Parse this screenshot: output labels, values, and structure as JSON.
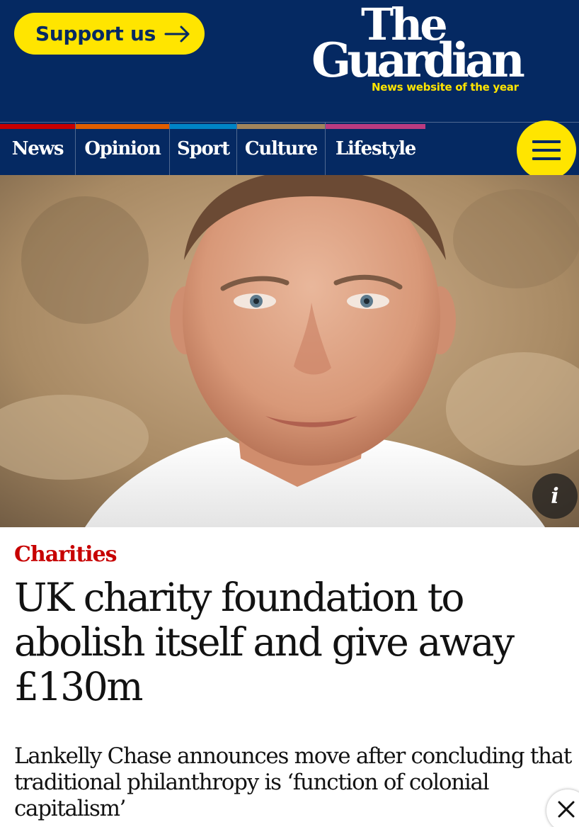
{
  "header": {
    "support_label": "Support us",
    "logo_line1": "The",
    "logo_line2": "Guardian",
    "tagline": "News website of the year"
  },
  "nav": {
    "items": [
      {
        "label": "News",
        "color": "#c70000"
      },
      {
        "label": "Opinion",
        "color": "#e05e00"
      },
      {
        "label": "Sport",
        "color": "#0084c6"
      },
      {
        "label": "Culture",
        "color": "#a1845c"
      },
      {
        "label": "Lifestyle",
        "color": "#bb3b80"
      }
    ]
  },
  "article": {
    "section": "Charities",
    "headline": "UK charity foundation to abolish itself and give away £130m",
    "standfirst": "Lankelly Chase announces move after concluding that traditional philanthropy is ‘function of colonial capitalism’"
  },
  "icons": {
    "support_arrow": "arrow-right-icon",
    "menu": "hamburger-icon",
    "info": "info-icon",
    "close": "close-icon"
  },
  "colors": {
    "brand_blue": "#052962",
    "brand_yellow": "#ffe500",
    "kicker_red": "#c70000"
  }
}
